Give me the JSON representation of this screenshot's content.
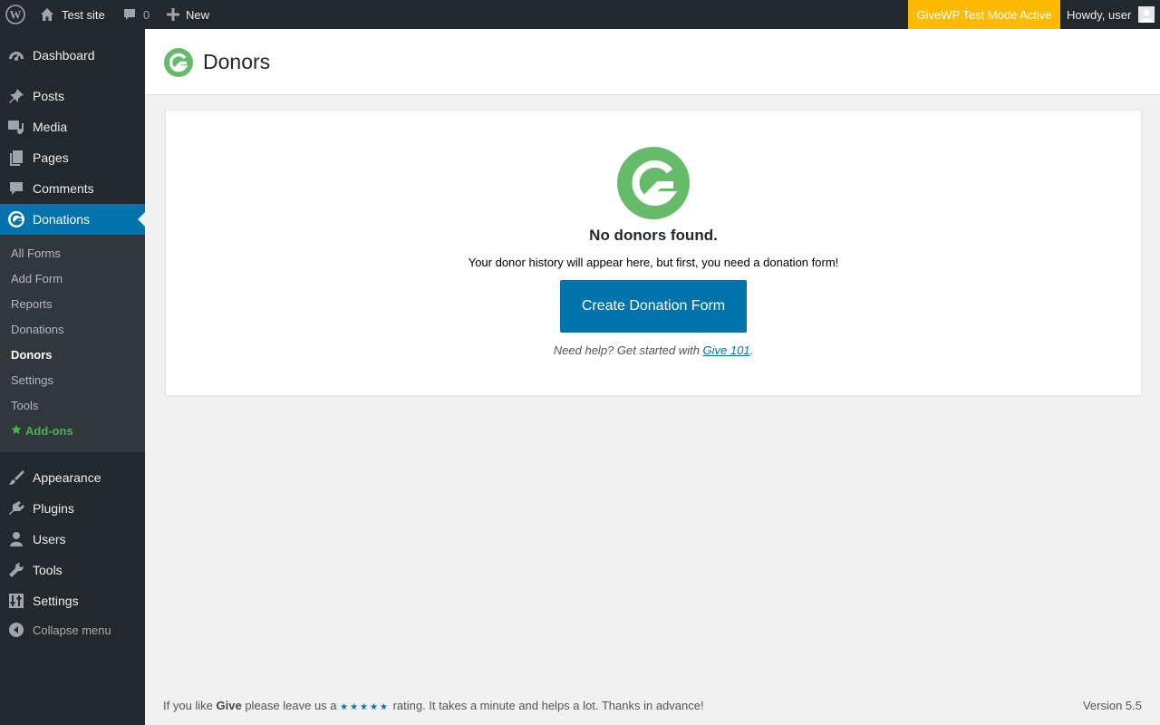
{
  "adminbar": {
    "site_name": "Test site",
    "comments_count": "0",
    "new_label": "New",
    "test_mode_label": "GiveWP Test Mode Active",
    "howdy_label": "Howdy, user",
    "test_mode_color": "#ffba00"
  },
  "sidebar": {
    "menu": [
      {
        "label": "Dashboard",
        "icon": "dashboard-icon"
      },
      {
        "label": "Posts",
        "icon": "pushpin-icon"
      },
      {
        "label": "Media",
        "icon": "media-icon"
      },
      {
        "label": "Pages",
        "icon": "pages-icon"
      },
      {
        "label": "Comments",
        "icon": "comment-icon"
      },
      {
        "label": "Donations",
        "icon": "give-icon"
      },
      {
        "label": "Appearance",
        "icon": "paintbrush-icon"
      },
      {
        "label": "Plugins",
        "icon": "plugin-icon"
      },
      {
        "label": "Users",
        "icon": "user-icon"
      },
      {
        "label": "Tools",
        "icon": "wrench-icon"
      },
      {
        "label": "Settings",
        "icon": "settings-icon"
      }
    ],
    "submenu": [
      {
        "label": "All Forms"
      },
      {
        "label": "Add Form"
      },
      {
        "label": "Reports"
      },
      {
        "label": "Donations"
      },
      {
        "label": "Donors"
      },
      {
        "label": "Settings"
      },
      {
        "label": "Tools"
      },
      {
        "label": "Add-ons"
      }
    ],
    "collapse_label": "Collapse menu",
    "accent_color": "#0073aa"
  },
  "header": {
    "title": "Donors"
  },
  "empty_state": {
    "heading": "No donors found.",
    "description": "Your donor history will appear here, but first, you need a donation form!",
    "button_label": "Create Donation Form",
    "help_prefix": "Need help? Get started with ",
    "help_link": "Give 101",
    "help_suffix": ".",
    "logo_color": "#66bb6a"
  },
  "footer": {
    "prefix": "If you like ",
    "brand": "Give",
    "middle": " please leave us a ",
    "stars": "★★★★★",
    "suffix": " rating. It takes a minute and helps a lot. Thanks in advance!",
    "version": "Version 5.5"
  }
}
